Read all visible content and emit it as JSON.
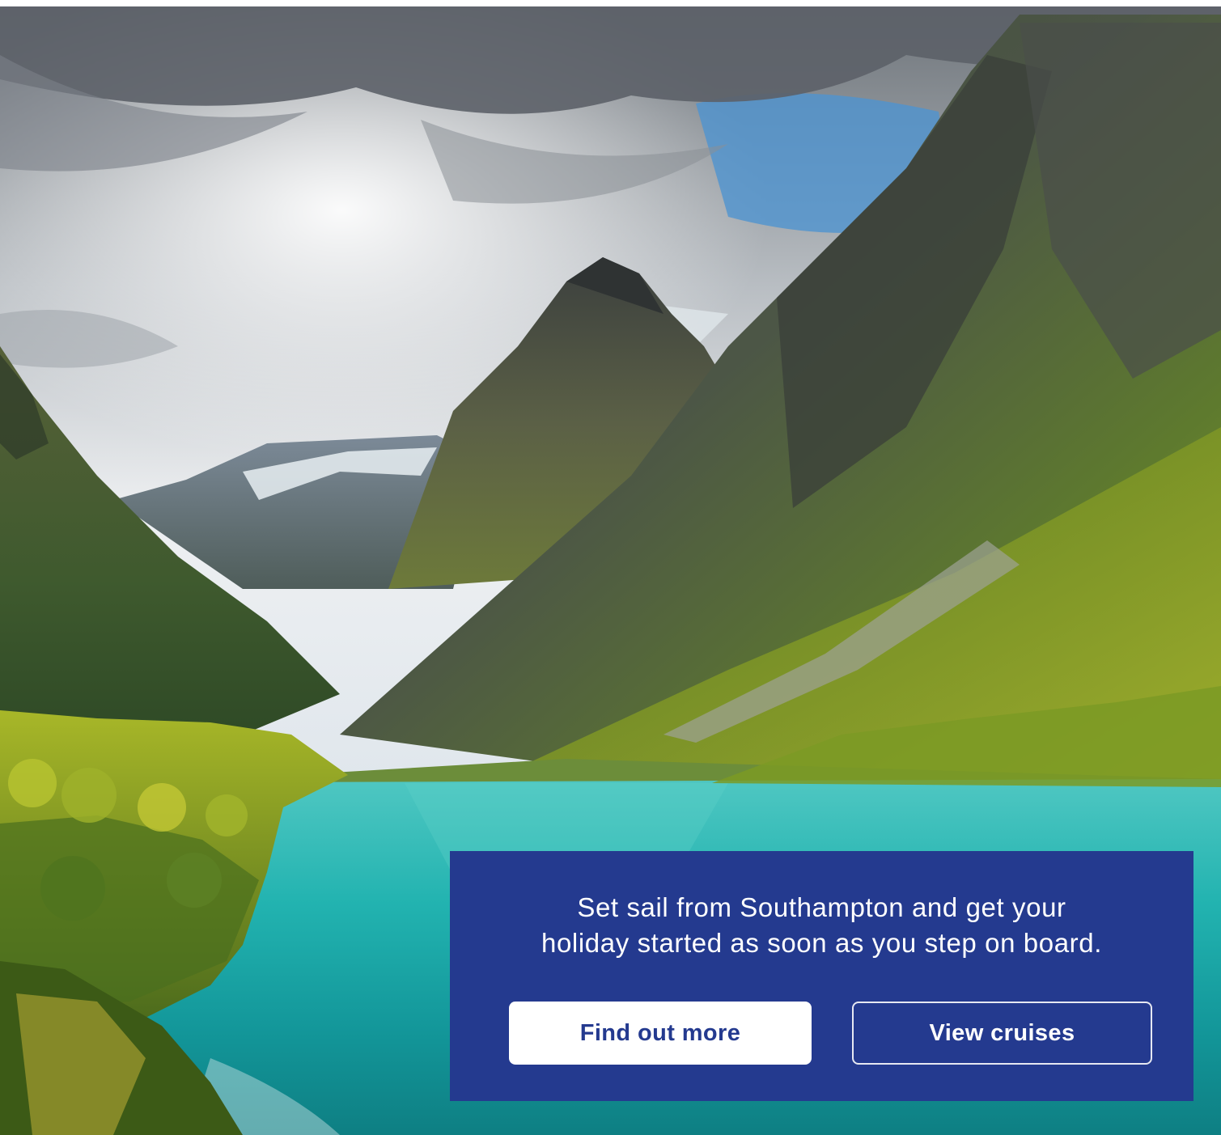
{
  "colors": {
    "panel": "#243a8f",
    "primary_button_bg": "#ffffff",
    "primary_button_text": "#243a8f",
    "secondary_button_text": "#ffffff",
    "page_bg": "#ffffff"
  },
  "hero": {
    "image_icon": "fjord-landscape-photo"
  },
  "promo": {
    "line_1": "Set sail from Southampton and get your",
    "line_2": "holiday started as soon as you step on board.",
    "find_out_more_label": "Find out more",
    "view_cruises_label": "View cruises"
  }
}
